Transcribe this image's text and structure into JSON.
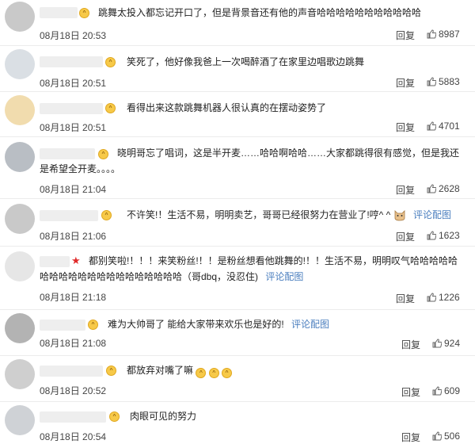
{
  "comments": [
    {
      "text": "跳舞太投入都忘记开口了，但是背景音还有他的声音哈哈哈哈哈哈哈哈哈哈哈",
      "time": "08月18日 20:53",
      "reply": "回复",
      "likes": "8987",
      "avatar_color": "#c9c9c9"
    },
    {
      "text": "笑死了，他好像我爸上一次喝醉酒了在家里边唱歌边跳舞",
      "time": "08月18日 20:51",
      "reply": "回复",
      "likes": "5883",
      "avatar_color": "#dadfe4"
    },
    {
      "text": "看得出来这款跳舞机器人很认真的在摆动姿势了",
      "time": "08月18日 20:51",
      "reply": "回复",
      "likes": "4701",
      "avatar_color": "#f1dcae"
    },
    {
      "text": "晓明哥忘了唱词，这是半开麦……哈哈啊哈哈……大家都跳得很有感觉，但是我还是希望全开麦。。。。",
      "time": "08月18日 21:04",
      "reply": "回复",
      "likes": "2628",
      "avatar_color": "#b9bec4"
    },
    {
      "text": "不许笑!！生活不易，明明卖艺，哥哥已经很努力在营业了!哼^ ^",
      "time": "08月18日 21:06",
      "reply": "回复",
      "likes": "1623",
      "link": "评论配图",
      "avatar_color": "#c9c9c9"
    },
    {
      "text": "都别笑啦!！！！来笑粉丝!！！是粉丝想看他跳舞的!！！生活不易，明明叹气哈哈哈哈哈哈哈哈哈哈哈哈哈哈哈哈哈哈哈哈（哥dbq，没忍住)",
      "time": "08月18日 21:18",
      "reply": "回复",
      "likes": "1226",
      "link": "评论配图",
      "avatar_color": "#e6e6e6"
    },
    {
      "text": "难为大帅哥了 能给大家带来欢乐也是好的!",
      "time": "08月18日 21:08",
      "reply": "回复",
      "likes": "924",
      "link": "评论配图",
      "avatar_color": "#b3b3b3"
    },
    {
      "text": "都放弃对嘴了嘛",
      "time": "08月18日 20:52",
      "reply": "回复",
      "likes": "609",
      "avatar_color": "#cfcfcf"
    },
    {
      "text": "肉眼可见的努力",
      "time": "08月18日 20:54",
      "reply": "回复",
      "likes": "506",
      "avatar_color": "#cfd2d6"
    }
  ],
  "icons": {
    "like": "thumbs-up-icon",
    "emoji": "laughing-emoji-icon",
    "badge": "vip-badge-icon",
    "sticker": "cat-sticker-icon"
  }
}
